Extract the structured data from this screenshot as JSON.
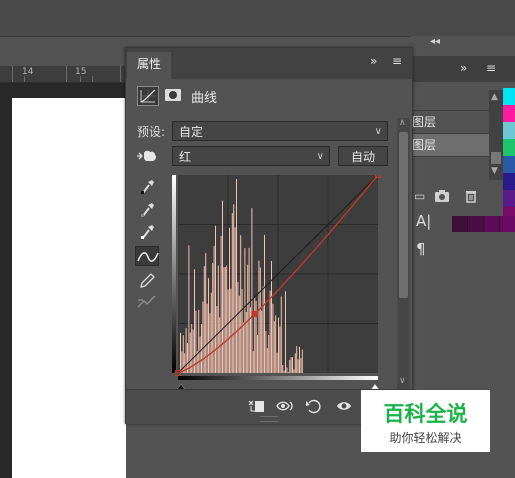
{
  "ruler": {
    "labels": [
      "14",
      "15"
    ]
  },
  "properties_panel": {
    "tab_label": "属性",
    "adjustment_name": "曲线",
    "preset_label": "预设:",
    "preset_value": "自定",
    "channel_value": "红",
    "auto_button": "自动",
    "tools": [
      "eyedropper-black",
      "eyedropper-gray",
      "eyedropper-white",
      "curve-point-tool",
      "pencil-tool",
      "smooth-tool"
    ],
    "footer_buttons": [
      "clip-to-layer",
      "view-previous-state",
      "reset",
      "visibility",
      "delete"
    ]
  },
  "curve": {
    "channel": "红",
    "points": [
      [
        0,
        0
      ],
      [
        98,
        76
      ],
      [
        255,
        255
      ]
    ],
    "histogram_color": "#f4c2b1",
    "curve_color": "#c0392b"
  },
  "layers_panel": {
    "rows": [
      "",
      "图层",
      "图层"
    ],
    "selected_index": 2
  },
  "swatches": [
    "#00e5f5",
    "#ff1aa0",
    "#6ec8d2",
    "#1ec46c",
    "#2a5aa8",
    "#2a1a8a",
    "#5a1a8a",
    "#7a0a6a"
  ],
  "watermark": {
    "title": "百科全说",
    "subtitle": "助你轻松解决"
  },
  "colors": {
    "panel": "#535353",
    "accent_green": "#1bb34a"
  }
}
